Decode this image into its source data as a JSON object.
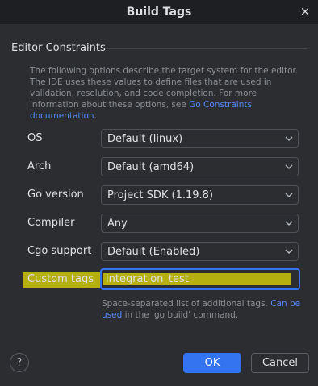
{
  "window": {
    "title": "Build Tags",
    "close_icon": "×"
  },
  "group": {
    "title": "Editor Constraints"
  },
  "description": {
    "text": "The following options describe the target system for the editor. The IDE uses these values to define files that are used in validation, resolution, and code completion. For more information about these options, see ",
    "link": "Go Constraints documentation",
    "end": "."
  },
  "fields": [
    {
      "label": "OS",
      "value": "Default (linux)"
    },
    {
      "label": "Arch",
      "value": "Default (amd64)"
    },
    {
      "label": "Go version",
      "value": "Project SDK (1.19.8)"
    },
    {
      "label": "Compiler",
      "value": "Any"
    },
    {
      "label": "Cgo support",
      "value": "Default (Enabled)"
    }
  ],
  "custom_tags": {
    "label": "Custom tags",
    "value": "integration_test",
    "hint_text": "Space-separated list of additional tags. ",
    "hint_link": "Can be used",
    "hint_end": " in the 'go build' command."
  },
  "footer": {
    "help": "?",
    "ok": "OK",
    "cancel": "Cancel"
  },
  "colors": {
    "accent": "#3574f0",
    "highlight": "#b5b00e",
    "link": "#548af7"
  }
}
